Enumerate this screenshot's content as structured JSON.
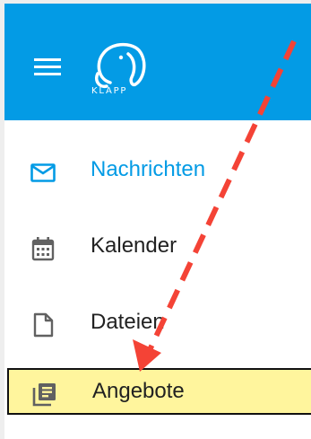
{
  "header": {
    "background_color": "#039be5",
    "menu_icon": "hamburger-menu-icon",
    "logo_icon": "klapp-elephant-logo-icon",
    "logo_text": "KLAPP"
  },
  "nav": {
    "items": [
      {
        "label": "Nachrichten",
        "icon": "envelope-icon",
        "active": true,
        "color": "#039be5"
      },
      {
        "label": "Kalender",
        "icon": "calendar-icon",
        "active": false
      },
      {
        "label": "Dateien",
        "icon": "file-icon",
        "active": false
      },
      {
        "label": "Angebote",
        "icon": "library-books-icon",
        "active": false,
        "highlighted": true,
        "highlight_color": "#fff59d"
      }
    ]
  },
  "annotation": {
    "type": "dashed-arrow",
    "color": "#f44336",
    "points_to": "Angebote"
  }
}
